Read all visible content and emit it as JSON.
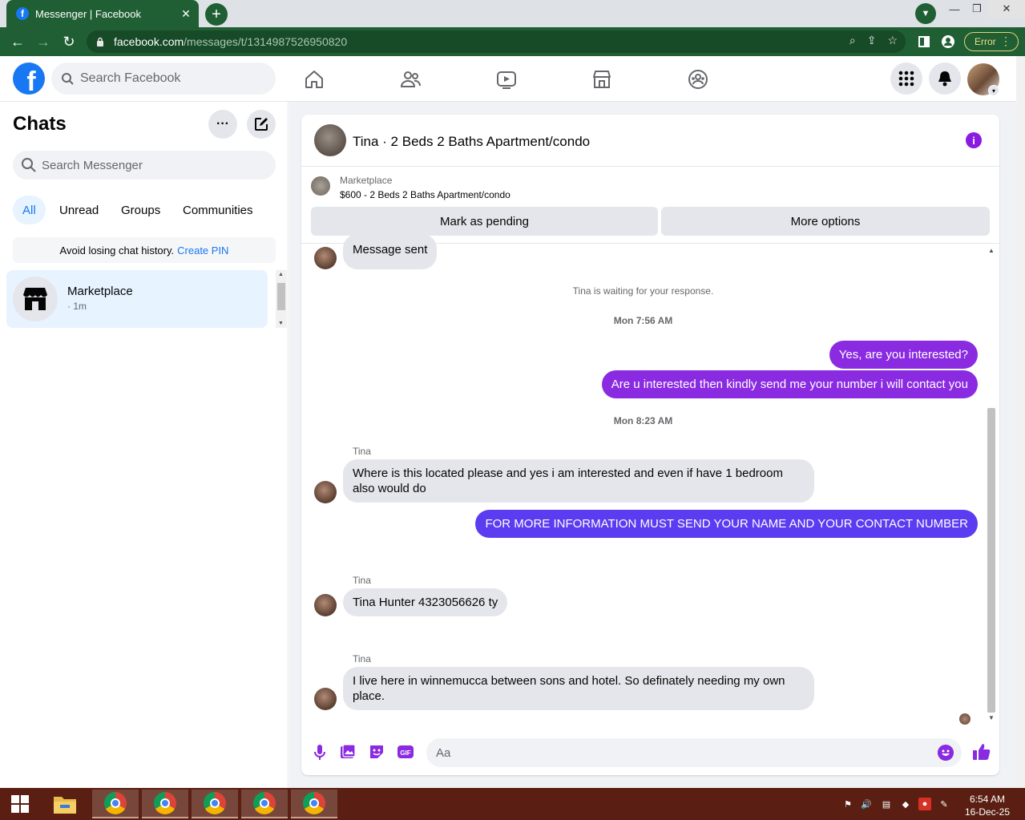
{
  "browser": {
    "tab_title": "Messenger | Facebook",
    "tab_close": "✕",
    "new_tab": "+",
    "url_host": "facebook.com",
    "url_path": "/messages/t/1314987526950820",
    "error_label": "Error",
    "win_minimize": "—",
    "win_restore": "❐",
    "win_close": "✕"
  },
  "fb": {
    "logo": "f",
    "search_placeholder": "Search Facebook",
    "nav_icons": [
      "home-icon",
      "friends-icon",
      "watch-icon",
      "marketplace-icon",
      "groups-icon"
    ]
  },
  "sidebar": {
    "title": "Chats",
    "search_placeholder": "Search Messenger",
    "filters": [
      "All",
      "Unread",
      "Groups",
      "Communities"
    ],
    "active_filter": "All",
    "pin_banner_text": "Avoid losing chat history.",
    "pin_link": "Create PIN",
    "chats": [
      {
        "name": "Marketplace",
        "time": "· 1m"
      }
    ]
  },
  "conversation": {
    "title": "Tina · 2 Beds 2 Baths Apartment/condo",
    "marketplace_label": "Marketplace",
    "listing": "$600 - 2 Beds 2 Baths Apartment/condo",
    "mark_pending": "Mark as pending",
    "more_options": "More options",
    "info": "i",
    "messages": {
      "m1": "Message sent",
      "sys1": "Tina is waiting for your response.",
      "ts1": "Mon 7:56 AM",
      "out1": "Yes, are you interested?",
      "out2": "Are u interested then kindly send me your number i will contact you",
      "ts2": "Mon 8:23 AM",
      "sender1": "Tina",
      "in1": "Where is this located please and yes i am interested and even if have 1 bedroom also would do",
      "out3": "FOR MORE INFORMATION MUST SEND YOUR NAME AND YOUR CONTACT NUMBER",
      "sender2": "Tina",
      "in2": "Tina Hunter 4323056626 ty",
      "sender3": "Tina",
      "in3": "I live here in winnemucca between sons and hotel. So definately needing my own place."
    },
    "composer_placeholder": "Aa"
  },
  "taskbar": {
    "time": "6:54 AM",
    "date": "16-Dec-25"
  },
  "colors": {
    "accent": "#8a2be2",
    "fb_blue": "#1877f2",
    "browser_green": "#1f5f33",
    "taskbar": "#5a1f12"
  }
}
